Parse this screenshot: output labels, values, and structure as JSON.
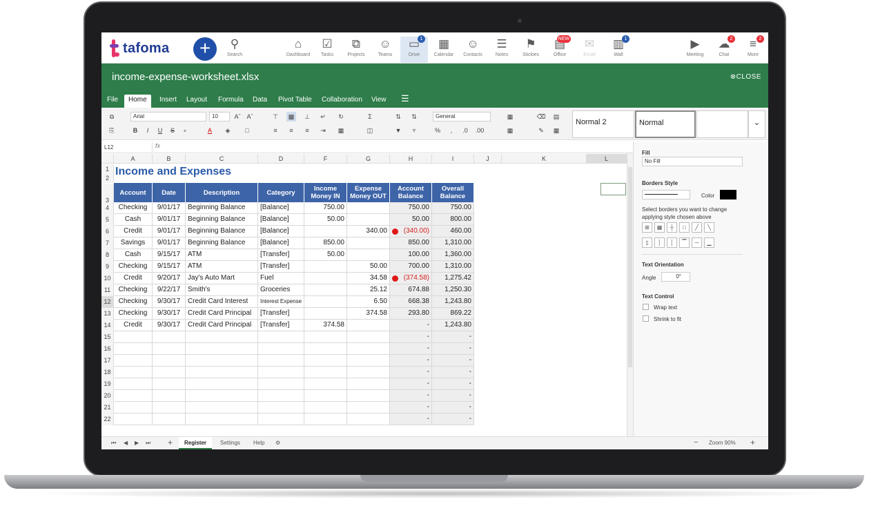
{
  "app": {
    "logo_text": "tafoma",
    "add_icon": "plus-icon"
  },
  "nav": {
    "search": "Search",
    "items": [
      {
        "label": "Dashboard",
        "icon": "home-icon"
      },
      {
        "label": "Tasks",
        "icon": "checkbox-icon"
      },
      {
        "label": "Projects",
        "icon": "projects-icon"
      },
      {
        "label": "Teams",
        "icon": "teams-icon"
      },
      {
        "label": "Drive",
        "icon": "folder-icon",
        "badge": "1"
      },
      {
        "label": "Calendar",
        "icon": "calendar-icon"
      },
      {
        "label": "Contacts",
        "icon": "contacts-icon"
      },
      {
        "label": "Notes",
        "icon": "notes-icon"
      },
      {
        "label": "Stickies",
        "icon": "bookmark-icon"
      },
      {
        "label": "Office",
        "icon": "office-icon",
        "badge": "NEW"
      },
      {
        "label": "Email",
        "icon": "mail-icon"
      },
      {
        "label": "Wall",
        "icon": "wall-icon",
        "badge": "1"
      },
      {
        "label": "Meeting",
        "icon": "video-icon"
      },
      {
        "label": "Chat",
        "icon": "chat-icon",
        "badge": "2"
      },
      {
        "label": "More",
        "icon": "menu-icon",
        "badge": "2"
      }
    ]
  },
  "file": {
    "name": "income-expense-worksheet.xlsx",
    "close": "CLOSE"
  },
  "menu": [
    "File",
    "Home",
    "Insert",
    "Layout",
    "Formula",
    "Data",
    "Pivot Table",
    "Collaboration",
    "View"
  ],
  "toolbar": {
    "font": "Arial",
    "size": "10",
    "number_format": "General",
    "style1": "Normal 2",
    "style2": "Normal"
  },
  "formula": {
    "cell_ref": "L12",
    "fx": "fx",
    "value": ""
  },
  "columns": [
    "A",
    "B",
    "C",
    "D",
    "F",
    "G",
    "H",
    "I",
    "J",
    "K",
    "L"
  ],
  "sheet_title": "Income and Expenses",
  "table_headers": [
    "Account",
    "Date",
    "Description",
    "Category",
    "Income Money IN",
    "Expense Money OUT",
    "Account Balance",
    "Overall Balance"
  ],
  "rows": [
    {
      "n": "4",
      "account": "Checking",
      "date": "9/01/17",
      "desc": "Beginning Balance",
      "cat": "[Balance]",
      "inc": "750.00",
      "exp": "",
      "bal": "750.00",
      "overall": "750.00"
    },
    {
      "n": "5",
      "account": "Cash",
      "date": "9/01/17",
      "desc": "Beginning Balance",
      "cat": "[Balance]",
      "inc": "50.00",
      "exp": "",
      "bal": "50.00",
      "overall": "800.00"
    },
    {
      "n": "6",
      "account": "Credit",
      "date": "9/01/17",
      "desc": "Beginning Balance",
      "cat": "[Balance]",
      "inc": "",
      "exp": "340.00",
      "bal": "(340.00)",
      "overall": "460.00",
      "neg": true
    },
    {
      "n": "7",
      "account": "Savings",
      "date": "9/01/17",
      "desc": "Beginning Balance",
      "cat": "[Balance]",
      "inc": "850.00",
      "exp": "",
      "bal": "850.00",
      "overall": "1,310.00"
    },
    {
      "n": "8",
      "account": "Cash",
      "date": "9/15/17",
      "desc": "ATM",
      "cat": "[Transfer]",
      "inc": "50.00",
      "exp": "",
      "bal": "100.00",
      "overall": "1,360.00"
    },
    {
      "n": "9",
      "account": "Checking",
      "date": "9/15/17",
      "desc": "ATM",
      "cat": "[Transfer]",
      "inc": "",
      "exp": "50.00",
      "bal": "700.00",
      "overall": "1,310.00"
    },
    {
      "n": "10",
      "account": "Credit",
      "date": "9/20/17",
      "desc": "Jay's Auto Mart",
      "cat": "Fuel",
      "inc": "",
      "exp": "34.58",
      "bal": "(374.58)",
      "overall": "1,275.42",
      "neg": true
    },
    {
      "n": "11",
      "account": "Checking",
      "date": "9/22/17",
      "desc": "Smith's",
      "cat": "Groceries",
      "inc": "",
      "exp": "25.12",
      "bal": "674.88",
      "overall": "1,250.30"
    },
    {
      "n": "12",
      "account": "Checking",
      "date": "9/30/17",
      "desc": "Credit Card Interest",
      "cat": "Interest Expense",
      "inc": "",
      "exp": "6.50",
      "bal": "668.38",
      "overall": "1,243.80",
      "small_cat": true
    },
    {
      "n": "13",
      "account": "Checking",
      "date": "9/30/17",
      "desc": "Credit Card Principal",
      "cat": "[Transfer]",
      "inc": "",
      "exp": "374.58",
      "bal": "293.80",
      "overall": "869.22"
    },
    {
      "n": "14",
      "account": "Credit",
      "date": "9/30/17",
      "desc": "Credit Card Principal",
      "cat": "[Transfer]",
      "inc": "374.58",
      "exp": "",
      "bal": "-",
      "overall": "1,243.80"
    }
  ],
  "empty_rows": [
    "15",
    "16",
    "17",
    "18",
    "19",
    "20",
    "21",
    "22"
  ],
  "empty_value": "-",
  "side": {
    "fill_label": "Fill",
    "fill_value": "No Fill",
    "borders_label": "Borders Style",
    "color_label": "Color",
    "border_color": "#000000",
    "borders_hint": "Select borders you want to change applying style chosen above",
    "orientation_label": "Text Orientation",
    "angle_label": "Angle",
    "angle_value": "0°",
    "control_label": "Text Control",
    "wrap": "Wrap text",
    "shrink": "Shrink to fit"
  },
  "sheets": [
    "Register",
    "Settings",
    "Help"
  ],
  "zoom": "Zoom 90%",
  "colors": {
    "accent": "#2e7d4a",
    "header": "#3e64a8",
    "negative": "#d42020"
  }
}
